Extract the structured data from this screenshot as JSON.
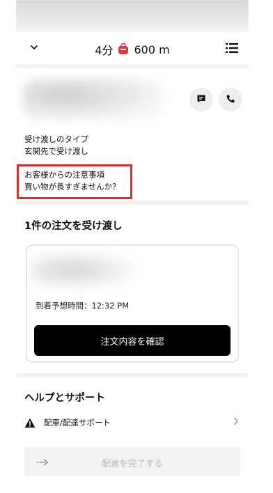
{
  "header": {
    "eta_time": "4分",
    "eta_distance": "600 m"
  },
  "handoff": {
    "type_label": "受け渡しのタイプ",
    "type_value": "玄関先で受け渡し",
    "note_label": "お客様からの注意事項",
    "note_value": "買い物が長すぎませんか？"
  },
  "orders": {
    "title": "1件の注文を受け渡し",
    "arrival_label": "到着予想時間：12:32 PM",
    "confirm_label": "注文内容を確認"
  },
  "help": {
    "title": "ヘルプとサポート",
    "item_label": "配車/配達サポート"
  },
  "complete": {
    "label": "配達を完了する"
  },
  "colors": {
    "bag_icon": "#e0353b",
    "highlight": "#e02b2b"
  }
}
